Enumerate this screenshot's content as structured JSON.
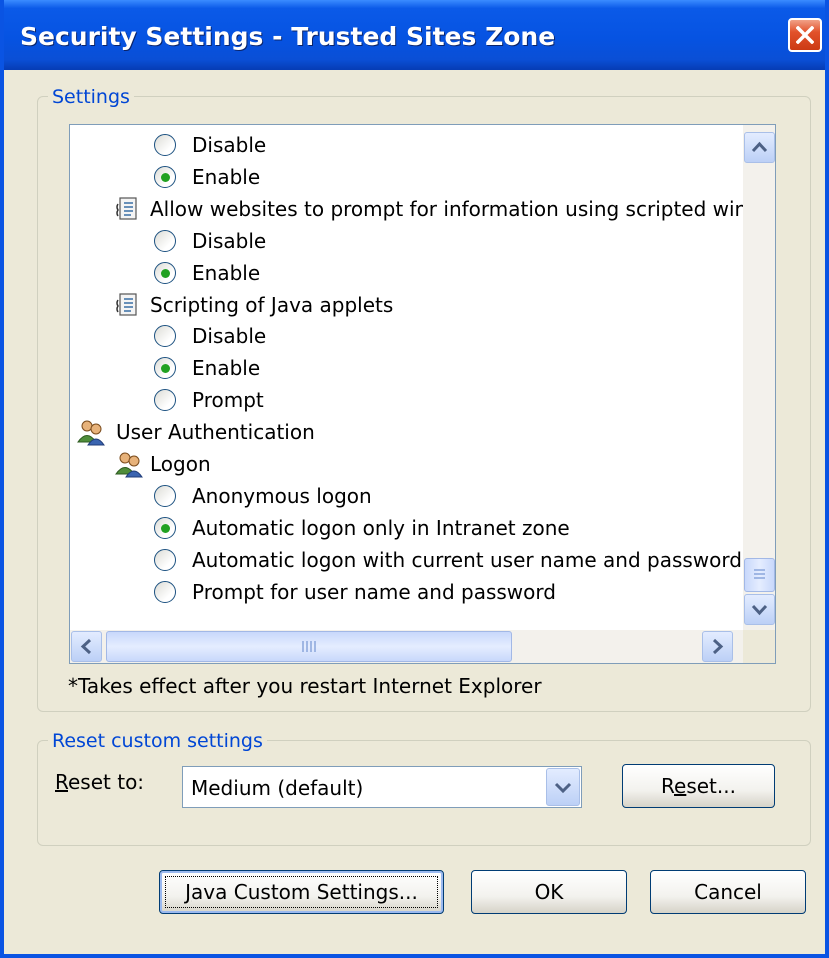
{
  "window": {
    "title": "Security Settings - Trusted Sites Zone"
  },
  "settings_group": {
    "legend": "Settings",
    "tree_rows": [
      {
        "kind": "radio",
        "label": "Disable",
        "checked": false,
        "indent": 2
      },
      {
        "kind": "radio",
        "label": "Enable",
        "checked": true,
        "indent": 2
      },
      {
        "kind": "setting",
        "label": "Allow websites to prompt for information using scripted windo",
        "icon": "script-setting-icon",
        "indent": 1
      },
      {
        "kind": "radio",
        "label": "Disable",
        "checked": false,
        "indent": 2
      },
      {
        "kind": "radio",
        "label": "Enable",
        "checked": true,
        "indent": 2
      },
      {
        "kind": "setting",
        "label": "Scripting of Java applets",
        "icon": "script-setting-icon",
        "indent": 1
      },
      {
        "kind": "radio",
        "label": "Disable",
        "checked": false,
        "indent": 2
      },
      {
        "kind": "radio",
        "label": "Enable",
        "checked": true,
        "indent": 2
      },
      {
        "kind": "radio",
        "label": "Prompt",
        "checked": false,
        "indent": 2
      },
      {
        "kind": "category",
        "label": "User Authentication",
        "icon": "users-icon",
        "indent": 0
      },
      {
        "kind": "setting",
        "label": "Logon",
        "icon": "users-icon",
        "indent": 1
      },
      {
        "kind": "radio",
        "label": "Anonymous logon",
        "checked": false,
        "indent": 2
      },
      {
        "kind": "radio",
        "label": "Automatic logon only in Intranet zone",
        "checked": true,
        "indent": 2
      },
      {
        "kind": "radio",
        "label": "Automatic logon with current user name and password",
        "checked": false,
        "indent": 2
      },
      {
        "kind": "radio",
        "label": "Prompt for user name and password",
        "checked": false,
        "indent": 2
      }
    ],
    "footnote": "*Takes effect after you restart Internet Explorer"
  },
  "reset_group": {
    "legend": "Reset custom settings",
    "reset_to_label_accel": "R",
    "reset_to_label_rest": "eset to:",
    "reset_to_value": "Medium (default)",
    "reset_button_pre": "R",
    "reset_button_accel": "e",
    "reset_button_post": "set..."
  },
  "buttons": {
    "java_accel": "J",
    "java_rest": "ava Custom Settings...",
    "ok": "OK",
    "cancel": "Cancel"
  },
  "colors": {
    "title_bar": "#0653e2",
    "legend_text": "#0046d5",
    "radio_dot": "#21a121",
    "dialog_bg": "#ece9d8"
  }
}
